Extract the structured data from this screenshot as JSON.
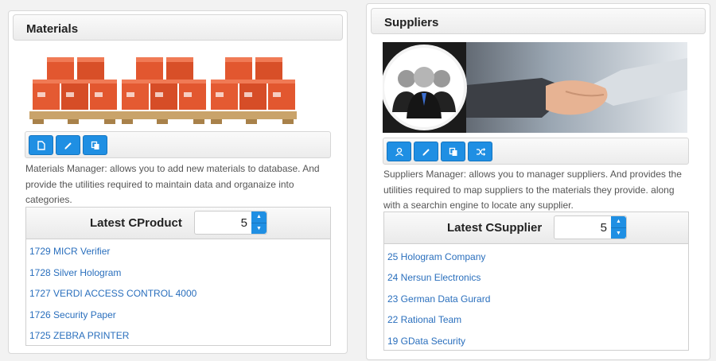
{
  "materials": {
    "title": "Materials",
    "description": "Materials Manager: allows you to add new materials to database. And provide the utilities required to maintain data and organaize into categories.",
    "latest_title": "Latest CProduct",
    "count_value": "5",
    "items": [
      "1729 MICR Verifier",
      "1728 Silver Hologram",
      "1727 VERDI ACCESS CONTROL 4000",
      "1726 Security Paper",
      "1725 ZEBRA PRINTER"
    ]
  },
  "suppliers": {
    "title": "Suppliers",
    "description": "Suppliers Manager: allows you to manager suppliers. And provides the utilities required to map suppliers to the materials they provide. along with a searchin engine to locate any supplier.",
    "latest_title": "Latest CSupplier",
    "count_value": "5",
    "items": [
      "25 Hologram Company",
      "24 Nersun Electronics",
      "23 German Data Gurard",
      "22 Rational Team",
      "19 GData Security"
    ]
  },
  "colors": {
    "accent": "#1f8fe3",
    "link": "#2a6fbd"
  },
  "icons": {
    "materials_toolbar": [
      "new-file-icon",
      "edit-icon",
      "copy-icon"
    ],
    "suppliers_toolbar": [
      "user-icon",
      "edit-icon",
      "copy-icon",
      "shuffle-icon"
    ]
  }
}
